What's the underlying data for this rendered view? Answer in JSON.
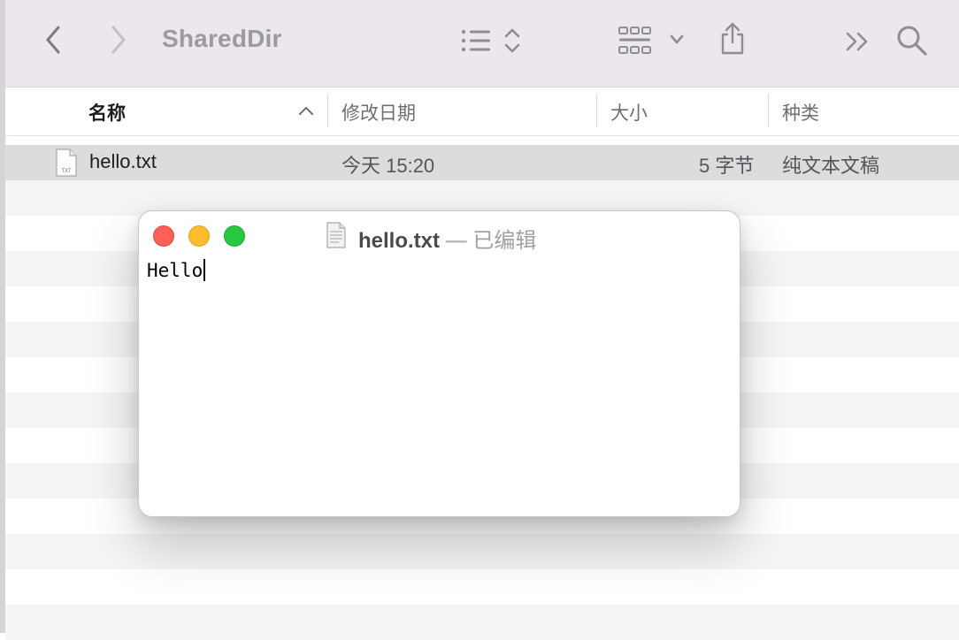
{
  "toolbar": {
    "title": "SharedDir",
    "icons": [
      "chevron-left-icon",
      "chevron-right-icon",
      "list-view-icon",
      "sort-updown-icon",
      "grid-view-icon",
      "chevron-down-icon",
      "share-icon",
      "more-chevrons-icon",
      "search-icon"
    ]
  },
  "columns": {
    "name": "名称",
    "modified": "修改日期",
    "size": "大小",
    "kind": "种类"
  },
  "files": [
    {
      "name": "hello.txt",
      "modified": "今天 15:20",
      "size": "5 字节",
      "kind": "纯文本文稿",
      "icon_label": "TXT"
    }
  ],
  "editor": {
    "filename": "hello.txt",
    "separator": "—",
    "state": "已编辑",
    "content": "Hello"
  },
  "colors": {
    "close": "#fe5f57",
    "minimize": "#febc2e",
    "zoom": "#28c840",
    "selection": "#dcdcdc"
  }
}
